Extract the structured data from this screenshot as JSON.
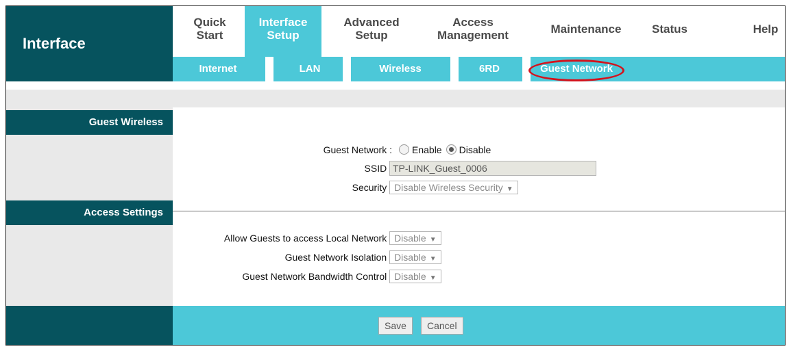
{
  "brand": {
    "title": "Interface"
  },
  "menu": [
    {
      "label1": "Quick",
      "label2": "Start"
    },
    {
      "label1": "Interface",
      "label2": "Setup",
      "active": true
    },
    {
      "label1": "Advanced",
      "label2": "Setup"
    },
    {
      "label1": "Access",
      "label2": "Management"
    },
    {
      "label1": "Maintenance",
      "label2": ""
    },
    {
      "label1": "Status",
      "label2": ""
    },
    {
      "label1": "Help",
      "label2": ""
    }
  ],
  "submenu": [
    "Internet",
    "LAN",
    "Wireless",
    "6RD",
    "Guest Network"
  ],
  "sections": {
    "guest_wireless": "Guest Wireless",
    "access_settings": "Access Settings"
  },
  "guest_wireless": {
    "guest_network_label": "Guest Network :",
    "enable_label": "Enable",
    "disable_label": "Disable",
    "guest_network_value": "Disable",
    "ssid_label": "SSID :",
    "ssid_value": "TP-LINK_Guest_0006",
    "security_label": "Security :",
    "security_value": "Disable Wireless Security"
  },
  "access_settings": {
    "local_network_label": "Allow Guests to access Local Network :",
    "local_network_value": "Disable",
    "isolation_label": "Guest Network Isolation :",
    "isolation_value": "Disable",
    "bandwidth_label": "Guest Network Bandwidth Control :",
    "bandwidth_value": "Disable"
  },
  "buttons": {
    "save": "Save",
    "cancel": "Cancel"
  },
  "colors": {
    "dark_teal": "#06535e",
    "accent_cyan": "#4cc8d8",
    "highlight_red": "#d4121c"
  }
}
